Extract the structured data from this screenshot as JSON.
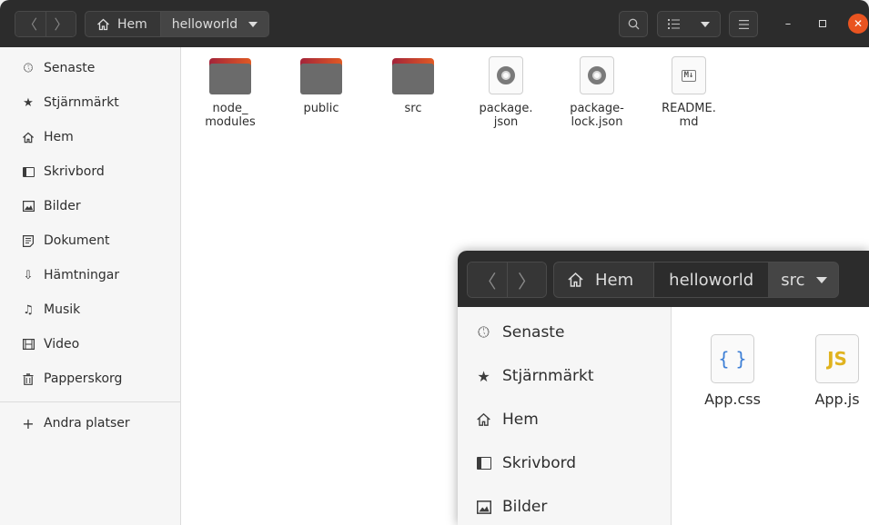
{
  "main_window": {
    "path": {
      "home": "Hem",
      "current": "helloworld"
    },
    "sidebar": {
      "items": [
        {
          "label": "Senaste",
          "icon": "clock-icon"
        },
        {
          "label": "Stjärnmärkt",
          "icon": "star-icon"
        },
        {
          "label": "Hem",
          "icon": "home-icon"
        },
        {
          "label": "Skrivbord",
          "icon": "desktop-icon"
        },
        {
          "label": "Bilder",
          "icon": "image-icon"
        },
        {
          "label": "Dokument",
          "icon": "document-icon"
        },
        {
          "label": "Hämtningar",
          "icon": "download-icon"
        },
        {
          "label": "Musik",
          "icon": "music-icon"
        },
        {
          "label": "Video",
          "icon": "video-icon"
        },
        {
          "label": "Papperskorg",
          "icon": "trash-icon"
        }
      ],
      "other_locations": "Andra platser"
    },
    "files": [
      {
        "name": "node_\nmodules",
        "type": "folder"
      },
      {
        "name": "public",
        "type": "folder"
      },
      {
        "name": "src",
        "type": "folder"
      },
      {
        "name": "package.\njson",
        "type": "json"
      },
      {
        "name": "package-\nlock.json",
        "type": "json"
      },
      {
        "name": "README.\nmd",
        "type": "markdown"
      }
    ]
  },
  "second_window": {
    "path": {
      "home": "Hem",
      "middle": "helloworld",
      "current": "src"
    },
    "sidebar": {
      "items": [
        {
          "label": "Senaste",
          "icon": "clock-icon"
        },
        {
          "label": "Stjärnmärkt",
          "icon": "star-icon"
        },
        {
          "label": "Hem",
          "icon": "home-icon"
        },
        {
          "label": "Skrivbord",
          "icon": "desktop-icon"
        },
        {
          "label": "Bilder",
          "icon": "image-icon"
        }
      ]
    },
    "files": [
      {
        "name": "App.css",
        "glyph": "{ }",
        "glyph_color": "#3d7fd6"
      },
      {
        "name": "App.js",
        "glyph": "JS",
        "glyph_color": "#e0b31f"
      }
    ]
  },
  "colors": {
    "headerbar": "#2c2c2c",
    "accent_close": "#e95420",
    "sidebar": "#f6f6f6"
  },
  "md_badge": "M↓"
}
